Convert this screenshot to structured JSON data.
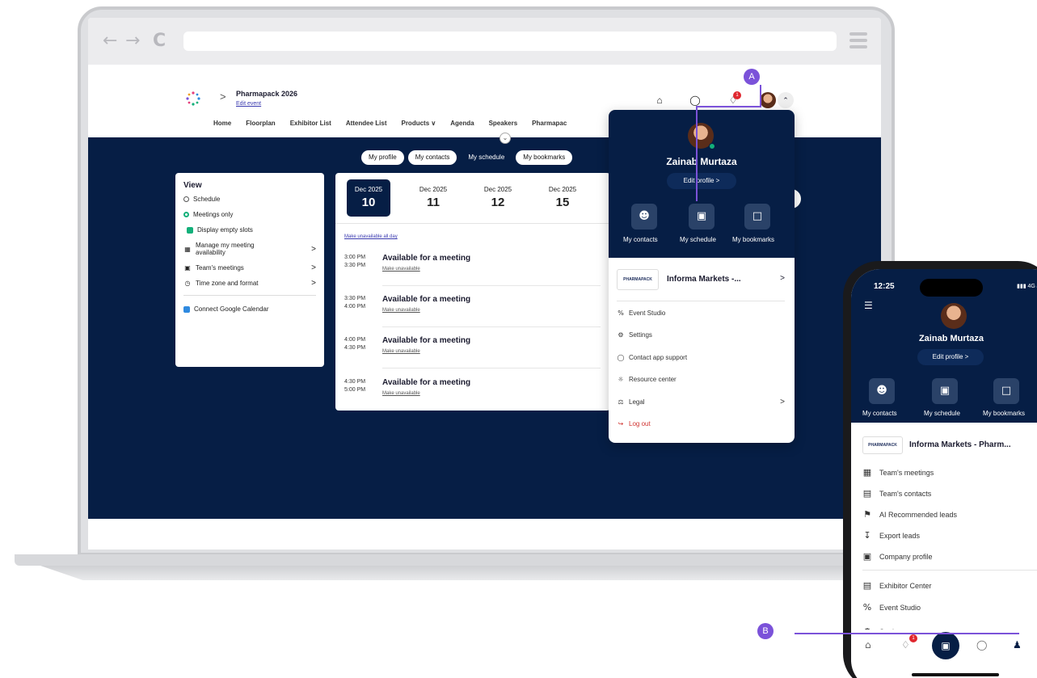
{
  "event": {
    "name": "Pharmapack 2026",
    "edit": "Edit event"
  },
  "nav": [
    "Home",
    "Floorplan",
    "Exhibitor List",
    "Attendee List",
    "Products ∨",
    "Agenda",
    "Speakers",
    "Pharmapac"
  ],
  "pills": [
    "My profile",
    "My contacts",
    "My schedule",
    "My bookmarks"
  ],
  "view": {
    "title": "View",
    "schedule": "Schedule",
    "meetings_only": "Meetings only",
    "empty_slots": "Display empty slots",
    "manage": "Manage my meeting availability",
    "teams": "Team's meetings",
    "timezone": "Time zone and format",
    "google": "Connect Google Calendar"
  },
  "dates": [
    {
      "month": "Dec 2025",
      "day": "10"
    },
    {
      "month": "Dec 2025",
      "day": "11"
    },
    {
      "month": "Dec 2025",
      "day": "12"
    },
    {
      "month": "Dec 2025",
      "day": "15"
    }
  ],
  "unavailable_all": "Make unavailable all day",
  "slots": [
    {
      "start": "3:00 PM",
      "end": "3:30 PM",
      "title": "Available for a meeting",
      "action": "Make unavailable"
    },
    {
      "start": "3:30 PM",
      "end": "4:00 PM",
      "title": "Available for a meeting",
      "action": "Make unavailable"
    },
    {
      "start": "4:00 PM",
      "end": "4:30 PM",
      "title": "Available for a meeting",
      "action": "Make unavailable"
    },
    {
      "start": "4:30 PM",
      "end": "5:00 PM",
      "title": "Available for a meeting",
      "action": "Make unavailable"
    }
  ],
  "profile": {
    "name": "Zainab Murtaza",
    "edit": "Edit profile  >",
    "tiles": [
      "My contacts",
      "My schedule",
      "My bookmarks"
    ],
    "org_logo": "PHARMAPACK",
    "org_short": "Informa Markets -...",
    "menu": [
      "Event Studio",
      "Settings",
      "Contact app support",
      "Resource center",
      "Legal",
      "Log out"
    ]
  },
  "callouts": {
    "a": "A",
    "b": "B"
  },
  "notif_count": "1",
  "phone": {
    "time": "12:25",
    "status": "4G",
    "org_name": "Informa Markets - Pharm...",
    "menu": [
      "Team's meetings",
      "Team's contacts",
      "AI Recommended leads",
      "Export leads",
      "Company profile",
      "Exhibitor Center",
      "Event Studio",
      "Settings"
    ]
  },
  "colors": {
    "navy": "#061e45",
    "accent": "#7b52d9",
    "green": "#13b07a"
  }
}
